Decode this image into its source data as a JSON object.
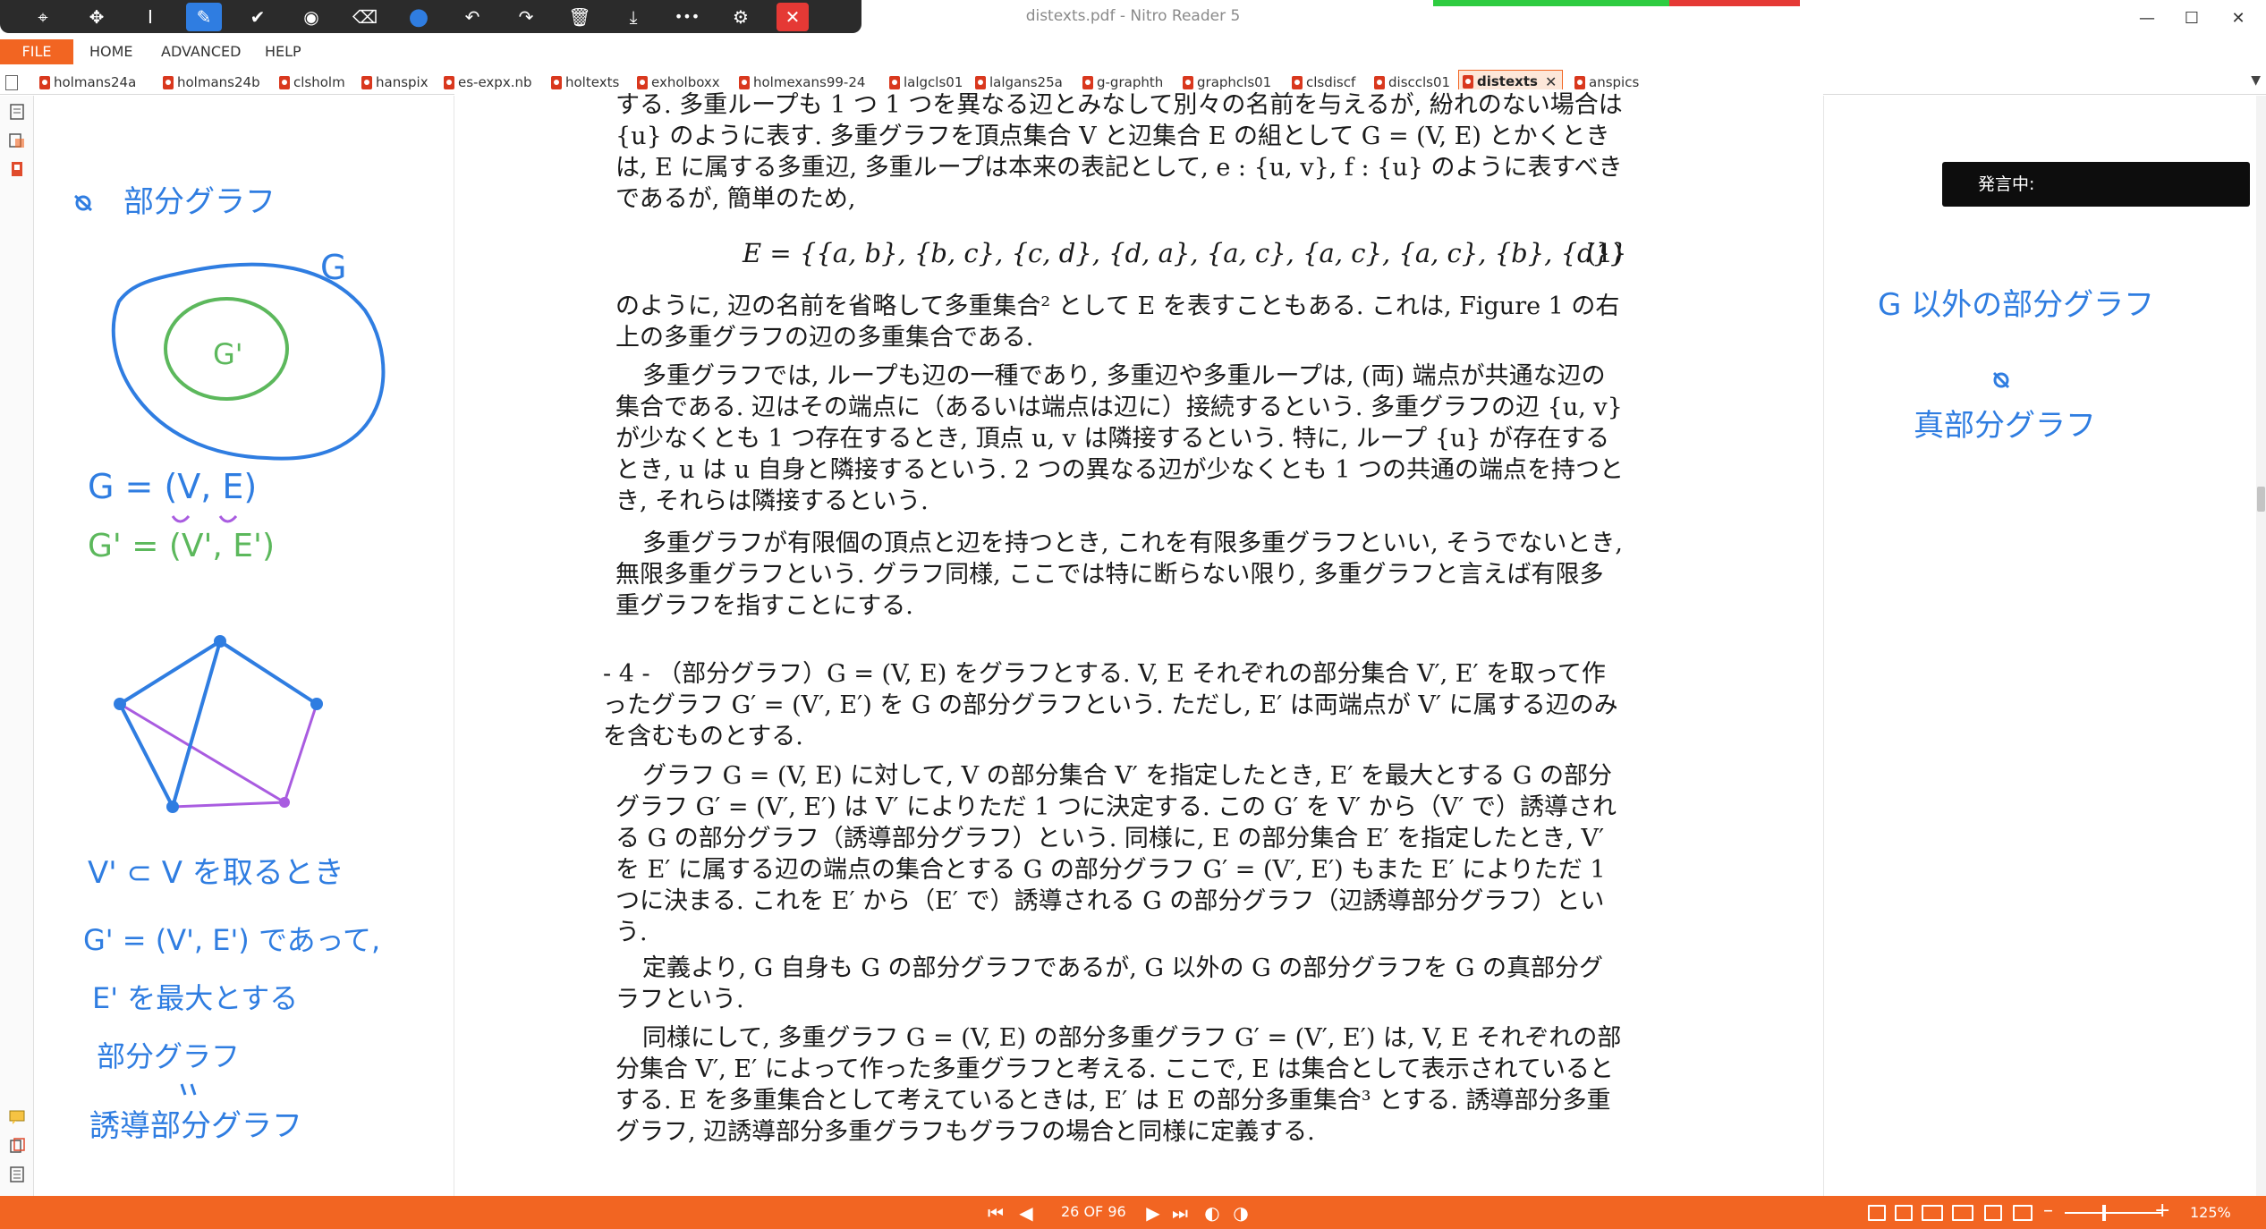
{
  "window": {
    "title": "distexts.pdf - Nitro Reader 5",
    "minimize": "—",
    "maximize": "☐",
    "close": "✕"
  },
  "pen_toolbar": {
    "tools": [
      {
        "name": "select-tool-icon",
        "glyph": "⌖"
      },
      {
        "name": "pan-tool-icon",
        "glyph": "✥"
      },
      {
        "name": "text-tool-icon",
        "glyph": "I"
      },
      {
        "name": "pen-tool-icon",
        "glyph": "✎"
      },
      {
        "name": "check-tool-icon",
        "glyph": "✔"
      },
      {
        "name": "highlighter-tool-icon",
        "glyph": "◉"
      },
      {
        "name": "eraser-tool-icon",
        "glyph": "⌫"
      },
      {
        "name": "color-picker-icon",
        "glyph": "●"
      },
      {
        "name": "undo-icon",
        "glyph": "↶"
      },
      {
        "name": "redo-icon",
        "glyph": "↷"
      },
      {
        "name": "delete-icon",
        "glyph": "🗑"
      },
      {
        "name": "save-ink-icon",
        "glyph": "⤓"
      },
      {
        "name": "more-options-icon",
        "glyph": "•••"
      },
      {
        "name": "ink-settings-icon",
        "glyph": "⚙"
      },
      {
        "name": "close-toolbar-icon",
        "glyph": "✕"
      }
    ],
    "active_color": "#2f7de1"
  },
  "menu": {
    "file": "FILE",
    "home": "HOME",
    "advanced": "ADVANCED",
    "help": "HELP"
  },
  "tabs": [
    {
      "label": "holmans24a"
    },
    {
      "label": "holmans24b"
    },
    {
      "label": "clsholm"
    },
    {
      "label": "hanspix"
    },
    {
      "label": "es-expx.nb"
    },
    {
      "label": "holtexts"
    },
    {
      "label": "exholboxx"
    },
    {
      "label": "holmexans99-24"
    },
    {
      "label": "lalgcls01"
    },
    {
      "label": "lalgans25a"
    },
    {
      "label": "g-graphth"
    },
    {
      "label": "graphcls01"
    },
    {
      "label": "clsdiscf"
    },
    {
      "label": "disccls01"
    },
    {
      "label": "distexts",
      "active": true
    },
    {
      "label": "anspics"
    }
  ],
  "document": {
    "para1": "する. 多重ループも 1 つ 1 つを異なる辺とみなして別々の名前を与えるが, 紛れのない場合は {u} のように表す. 多重グラフを頂点集合 V と辺集合 E の組として G = (V, E) とかくときは, E に属する多重辺, 多重ループは本来の表記として, e : {u, v}, f : {u} のように表すべきであるが, 簡単のため,",
    "equation": "E = {{a, b}, {b, c}, {c, d}, {d, a}, {a, c}, {a, c}, {a, c}, {b}, {d}}",
    "equation_number": "(1)",
    "para2": "のように, 辺の名前を省略して多重集合² として E を表すこともある. これは, Figure 1 の右上の多重グラフの辺の多重集合である.",
    "para3": "多重グラフでは, ループも辺の一種であり, 多重辺や多重ループは, (両) 端点が共通な辺の集合である. 辺はその端点に（あるいは端点は辺に）接続するという. 多重グラフの辺 {u, v} が少なくとも 1 つ存在するとき, 頂点 u, v は隣接するという. 特に, ループ {u} が存在するとき, u は u 自身と隣接するという. 2 つの異なる辺が少なくとも 1 つの共通の端点を持つとき, それらは隣接するという.",
    "para4": "多重グラフが有限個の頂点と辺を持つとき, これを有限多重グラフといい, そうでないとき, 無限多重グラフという. グラフ同様, ここでは特に断らない限り, 多重グラフと言えば有限多重グラフを指すことにする.",
    "para5": "- 4 - （部分グラフ）G = (V, E) をグラフとする. V, E それぞれの部分集合 V′, E′ を取って作ったグラフ G′ = (V′, E′) を G の部分グラフという. ただし, E′ は両端点が V′ に属する辺のみを含むものとする.",
    "para6": "グラフ G = (V, E) に対して, V の部分集合 V′ を指定したとき, E′ を最大とする G の部分グラフ G′ = (V′, E′) は V′ によりただ 1 つに決定する. この G′ を V′ から（V′ で）誘導される G の部分グラフ（誘導部分グラフ）という. 同様に, E の部分集合 E′ を指定したとき, V′ を E′ に属する辺の端点の集合とする G の部分グラフ G′ = (V′, E′) もまた E′ によりただ 1 つに決まる. これを E′ から（E′ で）誘導される G の部分グラフ（辺誘導部分グラフ）という.",
    "para7": "定義より, G 自身も G の部分グラフであるが, G 以外の G の部分グラフを G の真部分グラフという.",
    "para8": "同様にして, 多重グラフ G = (V, E) の部分多重グラフ G′ = (V′, E′) は, V, E それぞれの部分集合 V′, E′ によって作った多重グラフと考える. ここで, E は集合として表示されているとする. E を多重集合として考えているときは, E′ は E の部分多重集合³ とする. 誘導部分多重グラフ, 辺誘導部分多重グラフもグラフの場合と同様に定義する."
  },
  "handwriting_left": {
    "heading": "部分グラフ",
    "outer_label": "G",
    "inner_label": "G'",
    "g_def": "G = (V, E)",
    "g_prime_def": "G' = (V', E')",
    "note1": "V' ⊂ V を取るとき",
    "note2": "G' = (V', E') であって,",
    "note3": "E' を最大とする",
    "note4": "部分グラフ",
    "note5": "誘導部分グラフ",
    "ink_blue": "#2f7de1",
    "ink_green": "#5cb85c",
    "ink_purple": "#a95ce0"
  },
  "handwriting_right": {
    "line1": "G 以外の部分グラフ",
    "line2": "真部分グラフ"
  },
  "speaking_label": "発言中:",
  "status": {
    "page_indicator": "26 OF 96",
    "zoom": "125%",
    "accent": "#f26522"
  }
}
